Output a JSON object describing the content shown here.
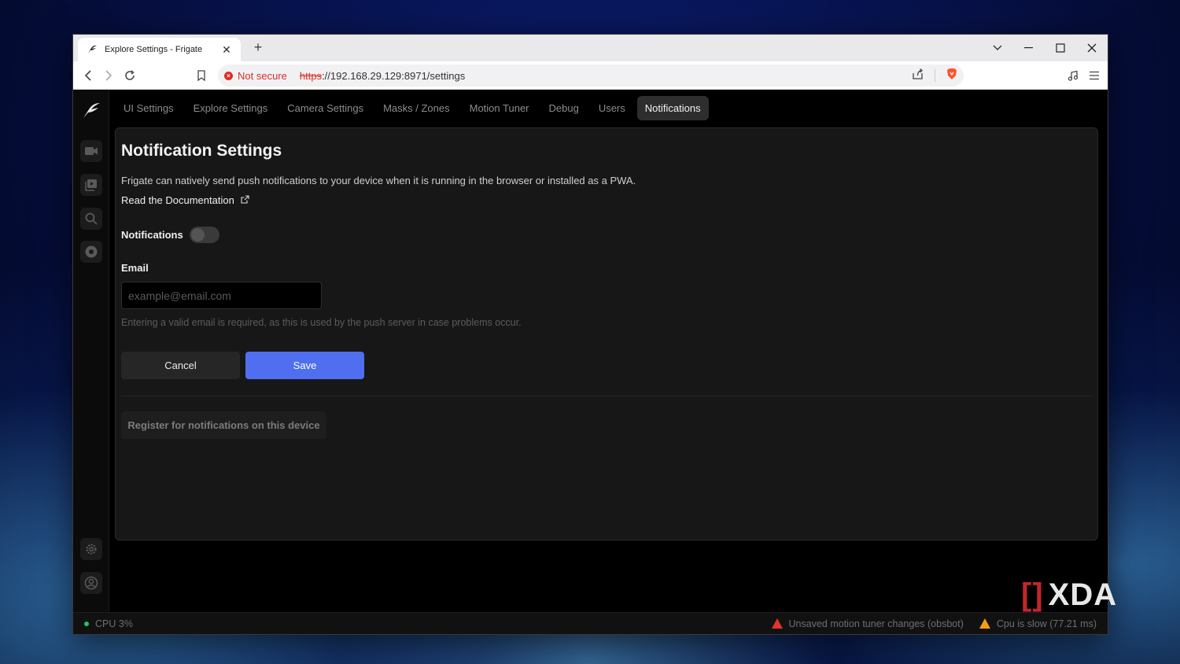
{
  "browser": {
    "tab_title": "Explore Settings - Frigate",
    "security_label": "Not secure",
    "url_protocol": "https",
    "url_rest": "://192.168.29.129:8971/settings"
  },
  "nav": {
    "tabs": [
      {
        "label": "UI Settings"
      },
      {
        "label": "Explore Settings"
      },
      {
        "label": "Camera Settings"
      },
      {
        "label": "Masks / Zones"
      },
      {
        "label": "Motion Tuner"
      },
      {
        "label": "Debug"
      },
      {
        "label": "Users"
      },
      {
        "label": "Notifications",
        "active": true
      }
    ]
  },
  "notifications": {
    "title": "Notification Settings",
    "description": "Frigate can natively send push notifications to your device when it is running in the browser or installed as a PWA.",
    "doc_link": "Read the Documentation",
    "toggle_label": "Notifications",
    "toggle_on": false,
    "email_label": "Email",
    "email_value": "",
    "email_placeholder": "example@email.com",
    "email_hint": "Entering a valid email is required, as this is used by the push server in case problems occur.",
    "cancel_label": "Cancel",
    "save_label": "Save",
    "register_label": "Register for notifications on this device"
  },
  "statusbar": {
    "cpu": "CPU 3%",
    "warning_1": "Unsaved motion tuner changes (obsbot)",
    "warning_2": "Cpu is slow (77.21 ms)"
  },
  "watermark": "XDA",
  "colors": {
    "accent": "#4f6ff0",
    "danger": "#e0342e",
    "warning": "#f59e0b",
    "ok": "#22c55e"
  },
  "icons": [
    "frigate-logo-icon",
    "camera-icon",
    "review-icon",
    "search-icon",
    "explore-icon",
    "settings-icon",
    "account-icon",
    "back-icon",
    "forward-icon",
    "reload-icon",
    "bookmark-icon",
    "share-icon",
    "brave-icon",
    "media-icon",
    "menu-icon",
    "external-link-icon",
    "warning-icon"
  ]
}
